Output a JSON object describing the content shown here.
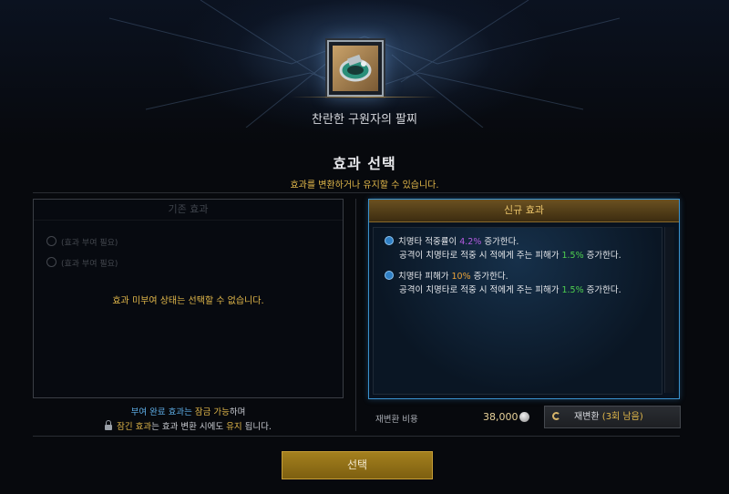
{
  "item": {
    "name": "찬란한 구원자의 팔찌",
    "icon": "bracelet-icon"
  },
  "header": {
    "title": "효과 선택",
    "subtitle": "효과를 변환하거나 유지할 수 있습니다."
  },
  "existing": {
    "title": "기존 효과",
    "slots": [
      "(효과 부여 필요)",
      "(효과 부여 필요)"
    ],
    "message": "효과 미부여 상태는 선택할 수 없습니다."
  },
  "new_effects": {
    "title": "신규 효과",
    "effects": [
      {
        "name_pre": "치명타 적중률이 ",
        "name_val": "4.2%",
        "name_post": " 증가한다.",
        "desc_pre": "공격이 치명타로 적중 시 적에게 주는 피해가 ",
        "desc_val": "1.5%",
        "desc_post": " 증가한다."
      },
      {
        "name_pre": "치명타 피해가 ",
        "name_val": "10%",
        "name_post": " 증가한다.",
        "desc_pre": "공격이 치명타로 적중 시 적에게 주는 피해가 ",
        "desc_val": "1.5%",
        "desc_post": " 증가한다."
      }
    ]
  },
  "notes": {
    "line1_a": "부여 완료 효과는 ",
    "line1_b": "잠금 가능",
    "line1_c": "하며",
    "line2_a": "잠긴 효과",
    "line2_b": "는 효과 변환 시에도 ",
    "line2_c": "유지",
    "line2_d": " 됩니다."
  },
  "reroll": {
    "cost_label": "재변환 비용",
    "cost_value": "38,000",
    "button_label": "재변환",
    "remaining": "(3회 남음)"
  },
  "actions": {
    "select_label": "선택"
  },
  "colors": {
    "accent_gold": "#e2b84a",
    "panel_border": "#3a92cf",
    "button_gold": "#a4801e"
  }
}
